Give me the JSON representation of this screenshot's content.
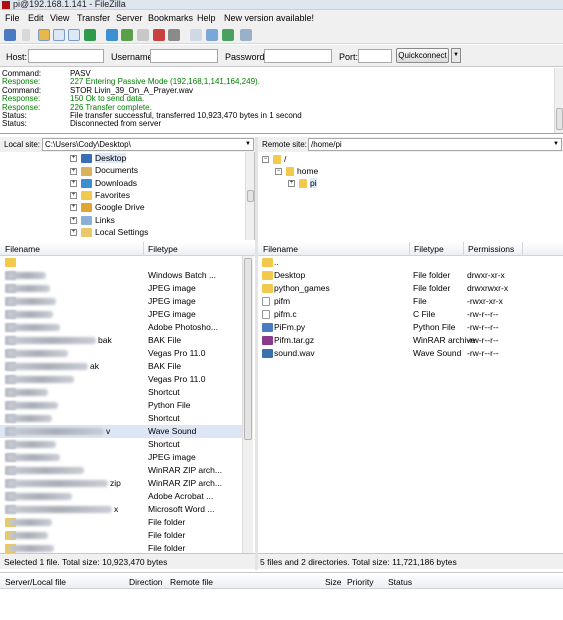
{
  "window": {
    "title": "pi@192.168.1.141 - FileZilla"
  },
  "menu": [
    "File",
    "Edit",
    "View",
    "Transfer",
    "Server",
    "Bookmarks",
    "Help",
    "New version available!"
  ],
  "quickconnect": {
    "host_label": "Host:",
    "user_label": "Username:",
    "pass_label": "Password:",
    "port_label": "Port:",
    "button": "Quickconnect",
    "arrow": "▼"
  },
  "log": [
    {
      "k": "Command:",
      "v": "PASV",
      "color": "#000000"
    },
    {
      "k": "Response:",
      "v": "227 Entering Passive Mode (192,168,1,141,164,249).",
      "color": "#008000"
    },
    {
      "k": "Command:",
      "v": "STOR Livin_39_On_A_Prayer.wav",
      "color": "#000000"
    },
    {
      "k": "Response:",
      "v": "150 Ok to send data.",
      "color": "#008000"
    },
    {
      "k": "Response:",
      "v": "226 Transfer complete.",
      "color": "#008000"
    },
    {
      "k": "Status:",
      "v": "File transfer successful, transferred 10,923,470 bytes in 1 second",
      "color": "#000000"
    },
    {
      "k": "Status:",
      "v": "Disconnected from server",
      "color": "#000000"
    }
  ],
  "local": {
    "site_label": "Local site:",
    "path": "C:\\Users\\Cody\\Desktop\\",
    "tree": [
      "Desktop",
      "Documents",
      "Downloads",
      "Favorites",
      "Google Drive",
      "Links",
      "Local Settings"
    ],
    "columns": [
      "Filename",
      "Filetype"
    ],
    "files": [
      {
        "name": "",
        "type": ""
      },
      {
        "name": "",
        "type": "Windows Batch ..."
      },
      {
        "name": "",
        "type": "JPEG image"
      },
      {
        "name": "",
        "type": "JPEG image"
      },
      {
        "name": "",
        "type": "JPEG image"
      },
      {
        "name": "",
        "type": "Adobe Photosho..."
      },
      {
        "name": "bak",
        "type": "BAK File"
      },
      {
        "name": "",
        "type": "Vegas Pro 11.0"
      },
      {
        "name": "ak",
        "type": "BAK File"
      },
      {
        "name": "",
        "type": "Vegas Pro 11.0"
      },
      {
        "name": "",
        "type": "Shortcut"
      },
      {
        "name": "",
        "type": "Python File"
      },
      {
        "name": "",
        "type": "Shortcut"
      },
      {
        "name": "v",
        "type": "Wave Sound"
      },
      {
        "name": "",
        "type": "Shortcut"
      },
      {
        "name": "",
        "type": "JPEG image"
      },
      {
        "name": "",
        "type": "WinRAR ZIP arch..."
      },
      {
        "name": "zip",
        "type": "WinRAR ZIP arch..."
      },
      {
        "name": "",
        "type": "Adobe Acrobat ..."
      },
      {
        "name": "x",
        "type": "Microsoft Word ..."
      },
      {
        "name": "",
        "type": "File folder"
      },
      {
        "name": "",
        "type": "File folder"
      },
      {
        "name": "",
        "type": "File folder"
      }
    ],
    "status": "Selected 1 file. Total size: 10,923,470 bytes"
  },
  "remote": {
    "site_label": "Remote site:",
    "path": "/home/pi",
    "tree": [
      "/",
      "home",
      "pi"
    ],
    "columns": [
      "Filename",
      "Filetype",
      "Permissions"
    ],
    "files": [
      {
        "name": "..",
        "type": "",
        "perm": "",
        "icon": "folder"
      },
      {
        "name": "Desktop",
        "type": "File folder",
        "perm": "drwxr-xr-x",
        "icon": "folder"
      },
      {
        "name": "python_games",
        "type": "File folder",
        "perm": "drwxrwxr-x",
        "icon": "folder"
      },
      {
        "name": "pifm",
        "type": "File",
        "perm": "-rwxr-xr-x",
        "icon": "file"
      },
      {
        "name": "pifm.c",
        "type": "C File",
        "perm": "-rw-r--r--",
        "icon": "file"
      },
      {
        "name": "PiFm.py",
        "type": "Python File",
        "perm": "-rw-r--r--",
        "icon": "py"
      },
      {
        "name": "Pifm.tar.gz",
        "type": "WinRAR archive",
        "perm": "-rw-r--r--",
        "icon": "rar"
      },
      {
        "name": "sound.wav",
        "type": "Wave Sound",
        "perm": "-rw-r--r--",
        "icon": "wav"
      }
    ],
    "status": "5 files and 2 directories. Total size: 11,721,186 bytes"
  },
  "queue": {
    "columns": [
      "Server/Local file",
      "Direction",
      "Remote file",
      "Size",
      "Priority",
      "Status"
    ]
  }
}
